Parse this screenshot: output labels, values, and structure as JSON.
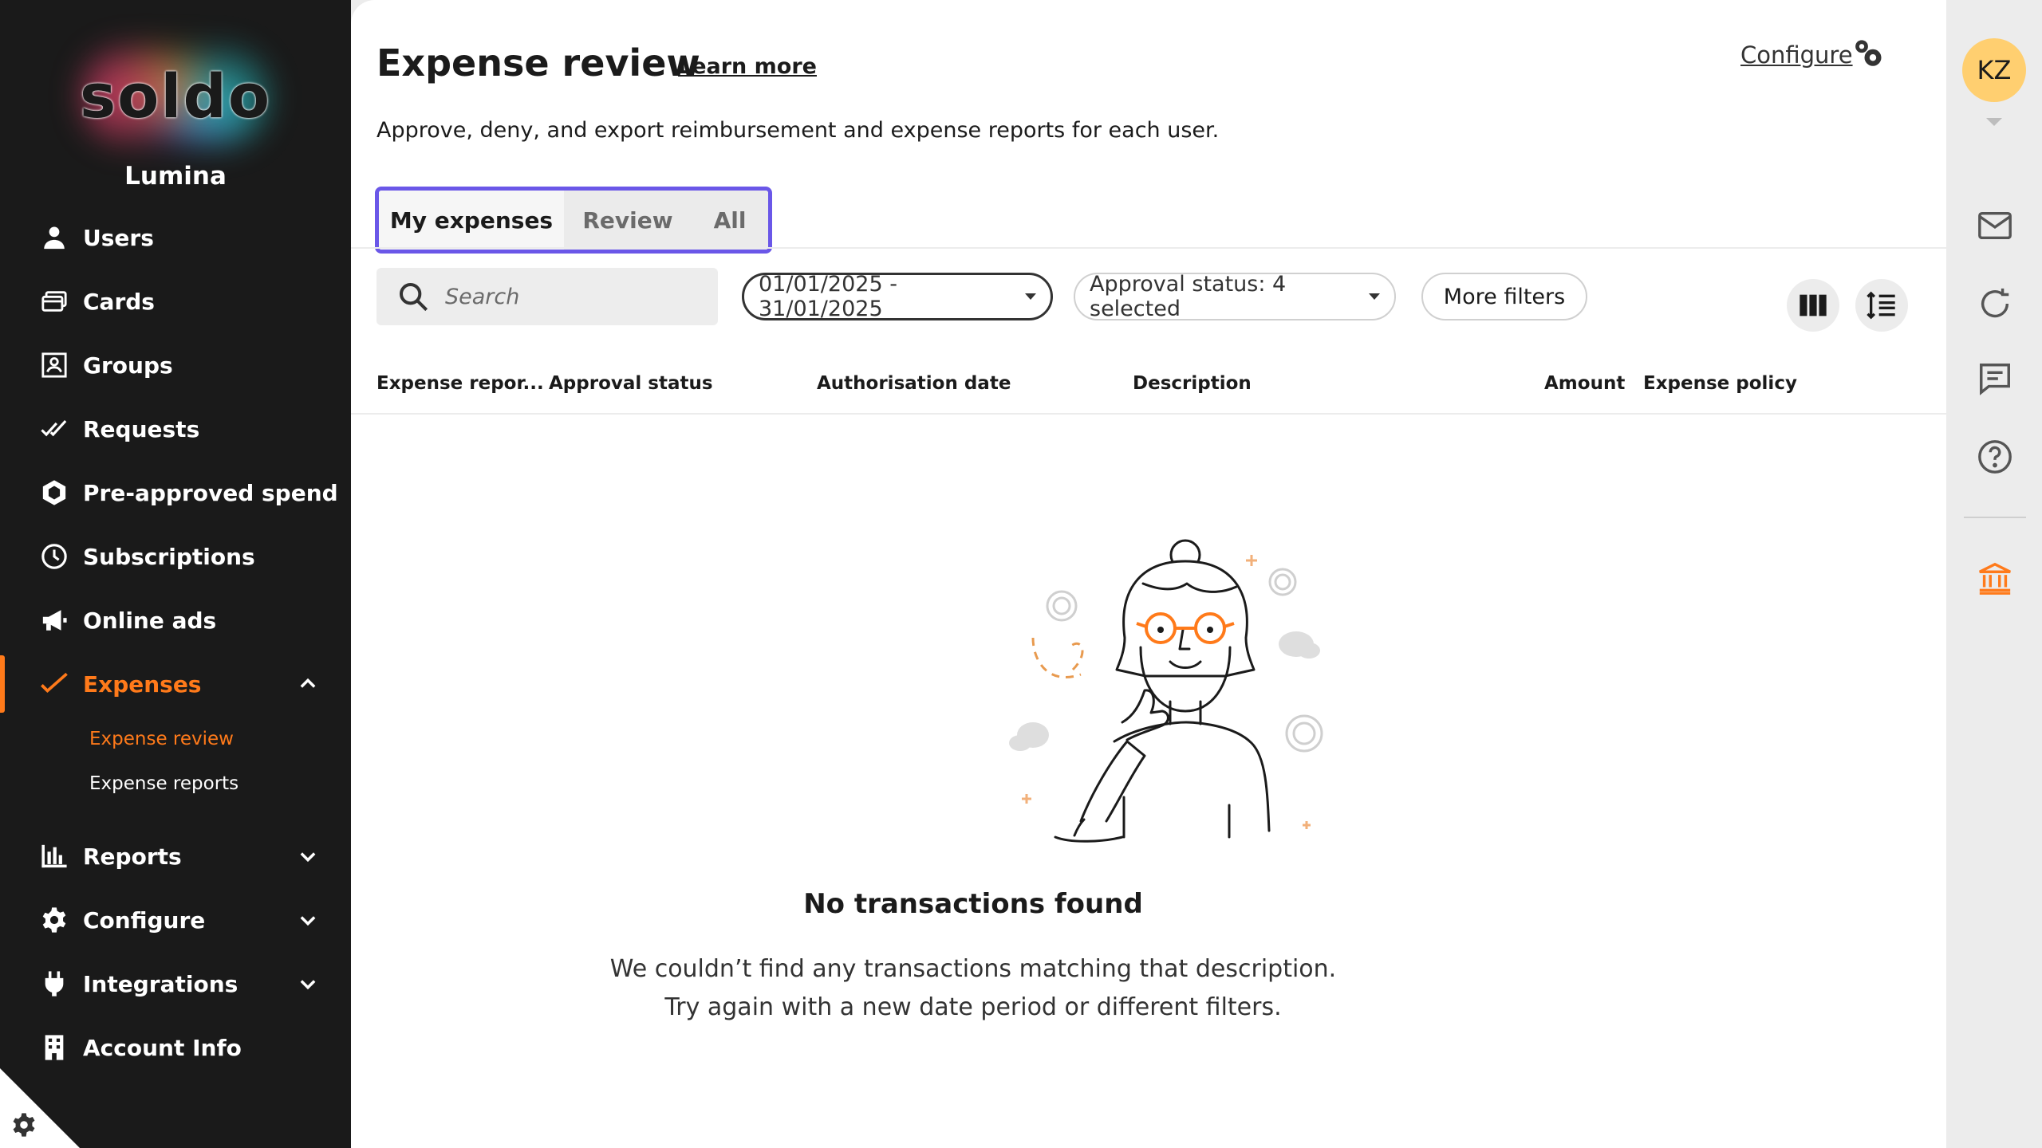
{
  "sidebar": {
    "logo_text": "soldo",
    "company": "Lumina",
    "items": [
      {
        "label": "Users",
        "icon": "user-icon"
      },
      {
        "label": "Cards",
        "icon": "cards-icon"
      },
      {
        "label": "Groups",
        "icon": "groups-icon"
      },
      {
        "label": "Requests",
        "icon": "double-check-icon"
      },
      {
        "label": "Pre-approved spend",
        "icon": "hexagon-icon"
      },
      {
        "label": "Subscriptions",
        "icon": "clock-icon"
      },
      {
        "label": "Online ads",
        "icon": "megaphone-icon"
      },
      {
        "label": "Expenses",
        "icon": "check-icon",
        "active": true,
        "expanded": true
      },
      {
        "label": "Reports",
        "icon": "bar-chart-icon"
      },
      {
        "label": "Configure",
        "icon": "gear-icon"
      },
      {
        "label": "Integrations",
        "icon": "plug-icon"
      },
      {
        "label": "Account Info",
        "icon": "building-icon"
      }
    ],
    "sub_items": [
      {
        "label": "Expense review",
        "active": true
      },
      {
        "label": "Expense reports"
      }
    ]
  },
  "header": {
    "title": "Expense review",
    "learn_more": "Learn more",
    "configure": "Configure",
    "description": "Approve, deny, and export reimbursement and expense reports for each user."
  },
  "tabs": [
    "My expenses",
    "Review",
    "All"
  ],
  "filters": {
    "search_placeholder": "Search",
    "date_range": "01/01/2025 - 31/01/2025",
    "approval_status": "Approval status: 4 selected",
    "more_filters": "More filters"
  },
  "table": {
    "columns": [
      "Expense repor...",
      "Approval status",
      "Authorisation date",
      "Description",
      "Amount",
      "Expense policy"
    ]
  },
  "empty_state": {
    "title": "No transactions found",
    "line1": "We couldn’t find any transactions matching that description.",
    "line2": "Try again with a new date period or different filters."
  },
  "user": {
    "initials": "KZ"
  },
  "colors": {
    "accent": "#ff7a1a",
    "tab_border": "#6a57e8",
    "sidebar_bg": "#1a1a1a",
    "avatar_bg": "#ffcf70"
  }
}
